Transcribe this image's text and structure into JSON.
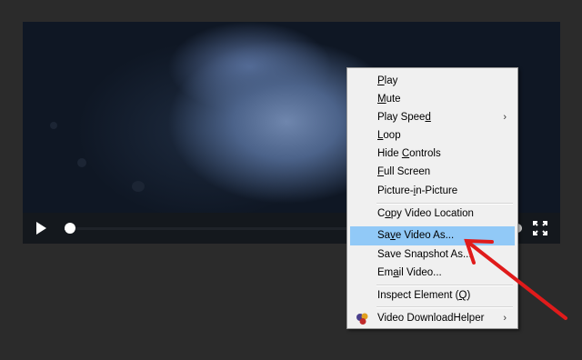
{
  "player": {
    "controls": {
      "play_icon": "play-icon",
      "fullscreen_icon": "fullscreen-icon",
      "progress_fraction": 0.02
    }
  },
  "context_menu": {
    "items": [
      {
        "pre": "",
        "key": "P",
        "post": "lay",
        "submenu": false
      },
      {
        "pre": "",
        "key": "M",
        "post": "ute",
        "submenu": false
      },
      {
        "pre": "Play Spee",
        "key": "d",
        "post": "",
        "submenu": true
      },
      {
        "pre": "",
        "key": "L",
        "post": "oop",
        "submenu": false
      },
      {
        "pre": "Hide ",
        "key": "C",
        "post": "ontrols",
        "submenu": false
      },
      {
        "pre": "",
        "key": "F",
        "post": "ull Screen",
        "submenu": false
      },
      {
        "pre": "Picture-",
        "key": "i",
        "post": "n-Picture",
        "submenu": false
      },
      {
        "pre": "C",
        "key": "o",
        "post": "py Video Location",
        "submenu": false
      },
      {
        "pre": "Sa",
        "key": "v",
        "post": "e Video As...",
        "submenu": false,
        "highlighted": true
      },
      {
        "pre": "Save Snapshot As",
        "key": "",
        "post": "...",
        "submenu": false
      },
      {
        "pre": "Em",
        "key": "a",
        "post": "il Video...",
        "submenu": false
      },
      {
        "pre": "Inspect Element (",
        "key": "Q",
        "post": ")",
        "submenu": false
      },
      {
        "pre": "Video DownloadHelper",
        "key": "",
        "post": "",
        "submenu": true,
        "icon": "video-downloadhelper-icon"
      }
    ],
    "submenu_glyph": "›",
    "highlight_color": "#91c9f7"
  },
  "annotation": {
    "arrow_color": "#e01b1b"
  }
}
